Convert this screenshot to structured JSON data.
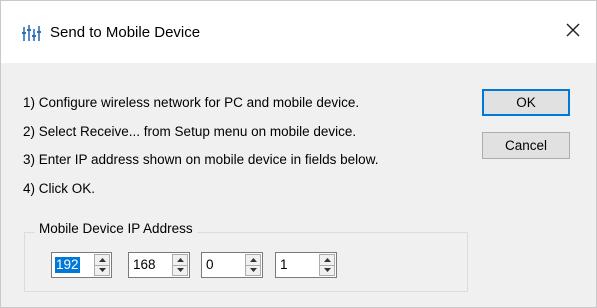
{
  "window": {
    "title": "Send to Mobile Device"
  },
  "instructions": [
    "1) Configure wireless network for PC and mobile device.",
    "2) Select Receive... from Setup menu on mobile device.",
    "3) Enter IP address shown on mobile device in fields below.",
    "4) Click OK."
  ],
  "buttons": {
    "ok_label": "OK",
    "cancel_label": "Cancel"
  },
  "ip_group": {
    "label": "Mobile Device IP Address",
    "octets": [
      "192",
      "168",
      "0",
      "1"
    ]
  },
  "colors": {
    "accent": "#0078d7",
    "dialog_bg": "#f0f0f0",
    "titlebar_bg": "#ffffff"
  },
  "icons": {
    "app": "equalizer-bars-icon",
    "close": "close-icon",
    "spin_up": "chevron-up-icon",
    "spin_down": "chevron-down-icon"
  }
}
